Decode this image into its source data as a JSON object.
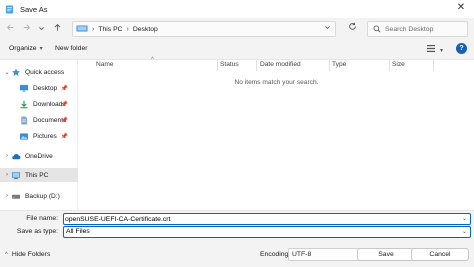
{
  "window": {
    "title": "Save As",
    "close_glyph": "✕"
  },
  "nav": {
    "back_icon": "arrow-left-icon",
    "forward_icon": "arrow-right-icon",
    "recent_icon": "chevron-down-icon",
    "up_icon": "arrow-up-icon",
    "breadcrumbs": [
      "This PC",
      "Desktop"
    ],
    "search_placeholder": "Search Desktop"
  },
  "toolbar": {
    "organize_label": "Organize",
    "new_folder_label": "New folder"
  },
  "sidebar": {
    "items": [
      {
        "label": "Quick access",
        "icon": "star-icon",
        "expandable": true,
        "expanded": true,
        "pinned": false
      },
      {
        "label": "Desktop",
        "icon": "desktop-icon",
        "expandable": false,
        "pinned": true
      },
      {
        "label": "Downloads",
        "icon": "download-icon",
        "expandable": false,
        "pinned": true
      },
      {
        "label": "Documents",
        "icon": "documents-icon",
        "expandable": false,
        "pinned": true
      },
      {
        "label": "Pictures",
        "icon": "pictures-icon",
        "expandable": false,
        "pinned": true
      },
      {
        "label": "OneDrive",
        "icon": "cloud-icon",
        "expandable": true,
        "expanded": false,
        "pinned": false
      },
      {
        "label": "This PC",
        "icon": "pc-icon",
        "expandable": true,
        "expanded": false,
        "selected": true
      },
      {
        "label": "Backup (D:)",
        "icon": "drive-icon",
        "expandable": true,
        "expanded": false
      }
    ]
  },
  "filelist": {
    "columns": [
      "Name",
      "Status",
      "Date modified",
      "Type",
      "Size"
    ],
    "empty_message": "No items match your search."
  },
  "fields": {
    "filename_label": "File name:",
    "filename_value": "openSUSE-UEFI-CA-Certificate.crt",
    "savetype_label": "Save as type:",
    "savetype_value": "All Files"
  },
  "footer": {
    "hide_folders_label": "Hide Folders",
    "encoding_label": "Encoding:",
    "encoding_value": "UTF-8",
    "save_label": "Save",
    "cancel_label": "Cancel"
  },
  "colors": {
    "accent": "#0067c0",
    "chrome": "#f3f3f3",
    "folder": "#f3c03b"
  }
}
